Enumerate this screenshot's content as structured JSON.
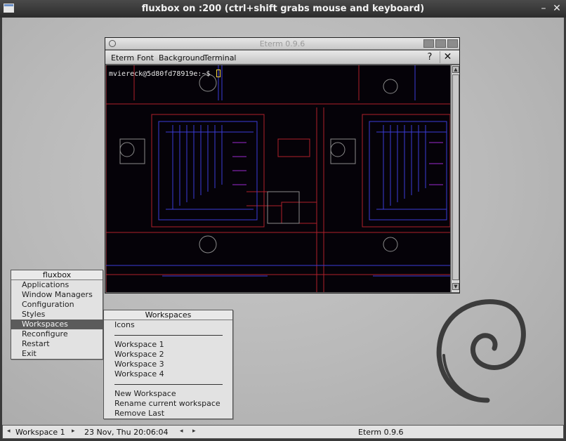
{
  "host_window": {
    "title": "fluxbox on :200 (ctrl+shift grabs mouse and keyboard)",
    "minimize_glyph": "–",
    "close_glyph": "✕"
  },
  "eterm": {
    "title": "Eterm 0.9.6",
    "menus": [
      "Eterm",
      "Font",
      "Background",
      "Terminal"
    ],
    "help_glyph": "?",
    "close_glyph": "✕",
    "prompt": "mviereck@5d80fd78919e:~$ "
  },
  "root_menu": {
    "title": "fluxbox",
    "items": [
      "Applications",
      "Window Managers",
      "Configuration",
      "Styles",
      "Workspaces",
      "Reconfigure",
      "Restart",
      "Exit"
    ],
    "active_item": "Workspaces"
  },
  "workspaces_menu": {
    "title": "Workspaces",
    "icons_label": "Icons",
    "workspaces": [
      "Workspace 1",
      "Workspace 2",
      "Workspace 3",
      "Workspace 4"
    ],
    "new_workspace": "New Workspace",
    "rename_workspace": "Rename current workspace",
    "remove_last": "Remove Last"
  },
  "toolbar": {
    "workspace": "Workspace 1",
    "clock": "23 Nov, Thu 20:06:04",
    "task": "Eterm 0.9.6",
    "left_arrow": "◂",
    "right_arrow": "▸"
  },
  "colors": {
    "terminal_bg": "#050208",
    "circuit_blue": "#3a3cd8",
    "circuit_red": "#b0202a",
    "menu_active": "#5b5b5b"
  },
  "icons": [
    "window-icon",
    "minimize-icon",
    "close-icon",
    "debian-swirl-icon",
    "eterm-menu-icon",
    "scroll-up-icon",
    "scroll-down-icon"
  ]
}
